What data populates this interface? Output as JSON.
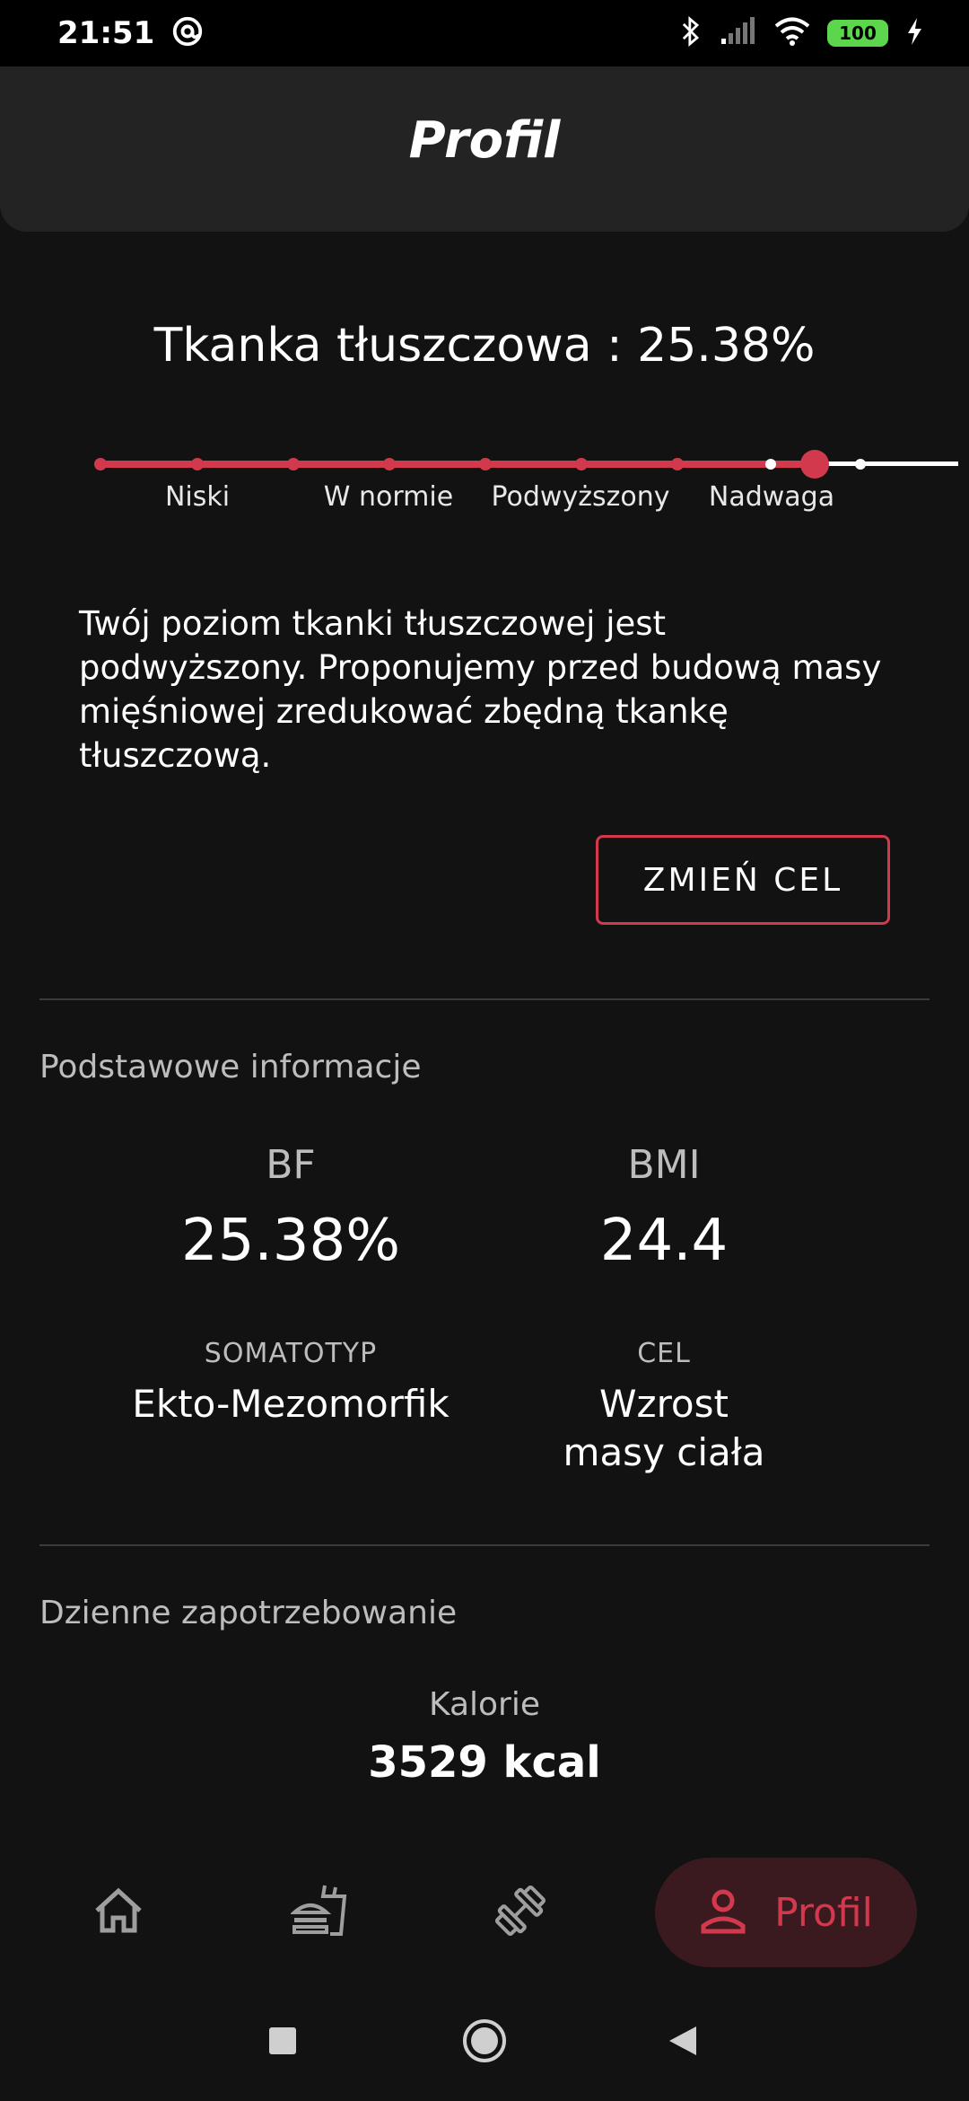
{
  "status_bar": {
    "time": "21:51",
    "battery": "100"
  },
  "app_bar": {
    "title": "Profil"
  },
  "body_fat": {
    "heading": "Tkanka tłuszczowa : 25.38%",
    "scale_labels": [
      "Niski",
      "W normie",
      "Podwyższony",
      "Nadwaga"
    ],
    "scale_steps": 9,
    "current_step": 7,
    "description": "Twój poziom tkanki tłuszczowej jest podwyższony. Proponujemy przed budową masy mięśniowej zredukować zbędną tkankę tłuszczową.",
    "change_goal_button": "ZMIEŃ CEL"
  },
  "basic_info": {
    "section_title": "Podstawowe informacje",
    "bf_label": "BF",
    "bf_value": "25.38%",
    "bmi_label": "BMI",
    "bmi_value": "24.4",
    "somatotype_label": "SOMATOTYP",
    "somatotype_value": "Ekto-Mezomorfik",
    "goal_label": "CEL",
    "goal_value": "Wzrost masy ciała"
  },
  "daily_needs": {
    "section_title": "Dzienne zapotrzebowanie",
    "calories_label": "Kalorie",
    "calories_value": "3529 kcal"
  },
  "bottom_nav": {
    "items": [
      {
        "icon": "home-icon"
      },
      {
        "icon": "food-icon"
      },
      {
        "icon": "dumbbell-icon"
      },
      {
        "icon": "person-icon",
        "label": "Profil",
        "active": true
      }
    ]
  },
  "colors": {
    "accent": "#d2394d",
    "background": "#121212",
    "app_bar": "#232323"
  }
}
